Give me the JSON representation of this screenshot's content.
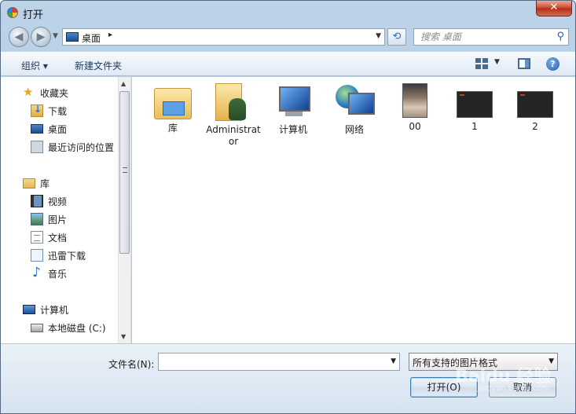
{
  "window": {
    "title": "打开",
    "close_glyph": "✕"
  },
  "address": {
    "location": "桌面",
    "arrow": "▸",
    "refresh_glyph": "⟲"
  },
  "search": {
    "placeholder": "搜索 桌面",
    "icon": "search-icon"
  },
  "toolbar": {
    "organize": "组织 ▾",
    "new_folder": "新建文件夹",
    "help": "?"
  },
  "nav": {
    "items": [
      {
        "label": "收藏夹",
        "icon": "star-icon"
      },
      {
        "label": "下载",
        "icon": "download-folder-icon"
      },
      {
        "label": "桌面",
        "icon": "desktop-icon"
      },
      {
        "label": "最近访问的位置",
        "icon": "recent-places-icon"
      },
      {
        "label": "库",
        "icon": "library-icon"
      },
      {
        "label": "视频",
        "icon": "video-icon"
      },
      {
        "label": "图片",
        "icon": "picture-icon"
      },
      {
        "label": "文档",
        "icon": "document-icon"
      },
      {
        "label": "迅雷下载",
        "icon": "xunlei-folder-icon"
      },
      {
        "label": "音乐",
        "icon": "music-icon"
      },
      {
        "label": "计算机",
        "icon": "computer-icon"
      },
      {
        "label": "本地磁盘 (C:)",
        "icon": "local-disk-icon"
      }
    ]
  },
  "content": {
    "items": [
      {
        "label": "库",
        "icon": "library-icon"
      },
      {
        "label": "Administrator",
        "icon": "user-folder-icon"
      },
      {
        "label": "计算机",
        "icon": "computer-icon"
      },
      {
        "label": "网络",
        "icon": "network-icon"
      },
      {
        "label": "00",
        "icon": "photo-thumbnail"
      },
      {
        "label": "1",
        "icon": "image-thumbnail"
      },
      {
        "label": "2",
        "icon": "image-thumbnail"
      }
    ]
  },
  "footer": {
    "filename_label": "文件名(N):",
    "filename_value": "",
    "filetype": "所有支持的图片格式",
    "open": "打开(O)",
    "cancel": "取消",
    "watermark": "Baidu 经验",
    "watermark_sub": "jingyan.baidu.com"
  },
  "colors": {
    "accent": "#1e5fb0",
    "close": "#c7432b",
    "frame": "#a9c3dc"
  }
}
